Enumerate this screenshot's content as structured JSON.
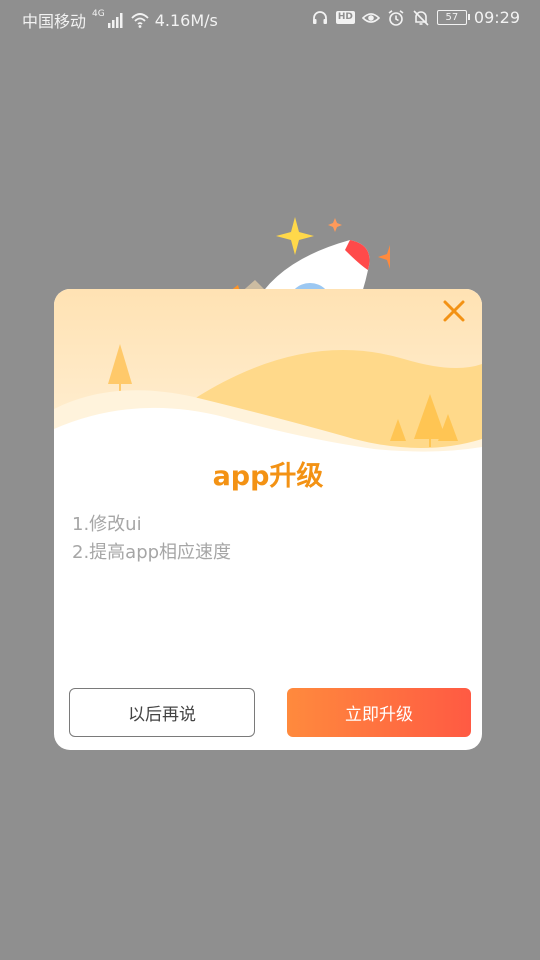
{
  "status_bar": {
    "carrier": "中国移动",
    "network_type": "4G",
    "speed": "4.16M/s",
    "hd_label": "HD",
    "battery": "57",
    "time": "09:29"
  },
  "dialog": {
    "title": "app升级",
    "notes": [
      "1.修改ui",
      "2.提高app相应速度"
    ],
    "later_button": "以后再说",
    "upgrade_button": "立即升级"
  },
  "colors": {
    "overlay": "#8f8f8f",
    "title": "#f39214",
    "accent_start": "#ff8a3d",
    "accent_end": "#ff5a43",
    "close": "#f39214"
  },
  "icons": [
    "headset-icon",
    "hd-icon",
    "eye-icon",
    "alarm-icon",
    "bell-off-icon",
    "battery-icon",
    "signal-icon",
    "wifi-icon",
    "close-icon",
    "rocket-illustration"
  ]
}
